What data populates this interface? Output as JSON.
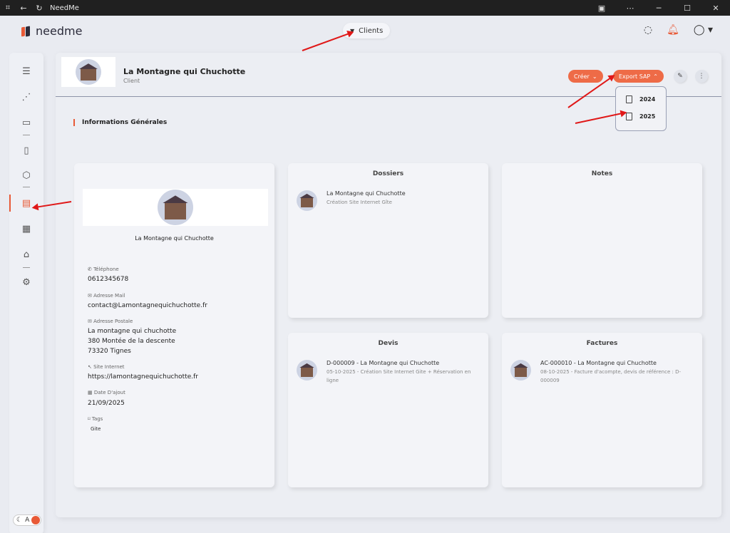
{
  "window": {
    "title": "NeedMe"
  },
  "app": {
    "logo_text": "needme",
    "context_label": "Clients"
  },
  "header": {
    "client_name": "La Montagne qui Chuchotte",
    "client_type": "Client",
    "create_label": "Créer",
    "export_label": "Export SAP"
  },
  "export_menu": {
    "items": [
      "2024",
      "2025"
    ]
  },
  "section": {
    "title": "Informations Générales"
  },
  "profile": {
    "name": "La Montagne qui Chuchotte",
    "phone_label": "Téléphone",
    "phone": "0612345678",
    "email_label": "Adresse Mail",
    "email": "contact@Lamontagnequichuchotte.fr",
    "address_label": "Adresse Postale",
    "address_line1": "La montagne qui chuchotte",
    "address_line2": "380 Montée de la descente",
    "address_line3": "73320 Tignes",
    "website_label": "Site Internet",
    "website": "https://lamontagnequichuchotte.fr",
    "date_label": "Date D'ajout",
    "date": "21/09/2025",
    "tags_label": "Tags",
    "tag": "Gite"
  },
  "dossiers": {
    "title": "Dossiers",
    "items": [
      {
        "title": "La Montagne qui Chuchotte",
        "subtitle": "Création Site Internet Gîte"
      }
    ]
  },
  "notes": {
    "title": "Notes"
  },
  "devis": {
    "title": "Devis",
    "items": [
      {
        "title": "D-000009 - La Montagne qui Chuchotte",
        "subtitle": "05-10-2025 - Création Site Internet Gite + Réservation en ligne"
      }
    ]
  },
  "factures": {
    "title": "Factures",
    "items": [
      {
        "title": "AC-000010 - La Montagne qui Chuchotte",
        "subtitle": "08-10-2025 - Facture d'acompte, devis de référence : D-000009"
      }
    ]
  },
  "theme_toggle": {
    "label": "A"
  },
  "colors": {
    "accent": "#e85a37",
    "annotation_arrow": "#e01818"
  }
}
